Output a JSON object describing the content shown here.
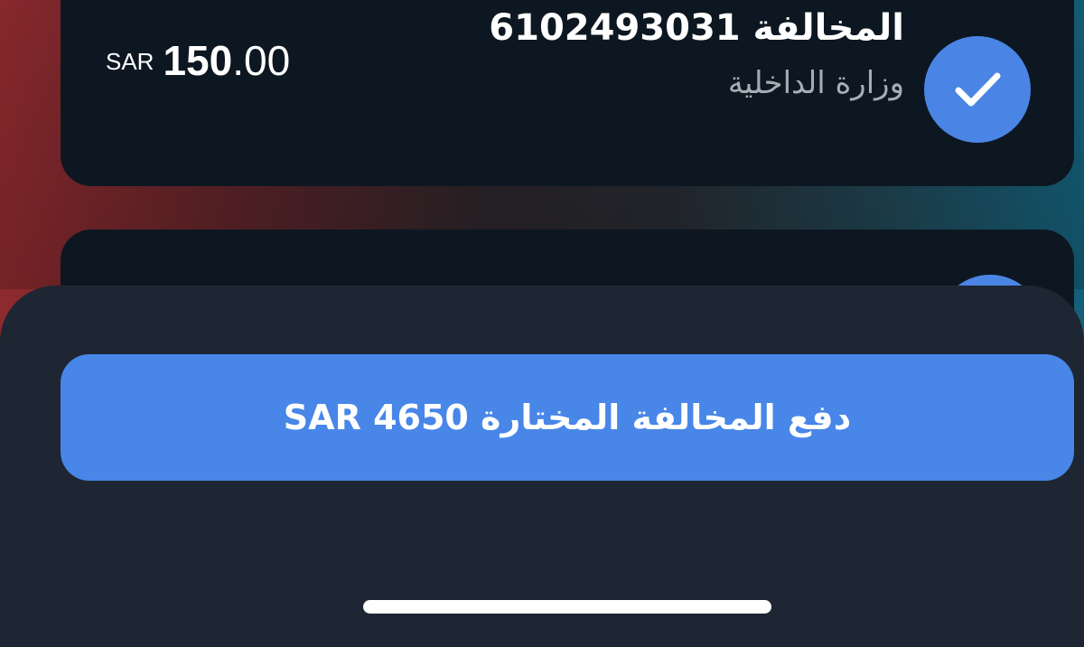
{
  "violations": [
    {
      "title": "المخالفة 6102493031",
      "authority": "وزارة الداخلية",
      "currency": "SAR",
      "amount_int": "150",
      "amount_dec": ".00",
      "selected": true
    },
    {
      "title": "",
      "authority": "",
      "selected": true
    }
  ],
  "pay_button": {
    "label": "دفع المخالفة المختارة SAR 4650"
  },
  "colors": {
    "accent": "#4886e8",
    "card_bg": "#0d1721",
    "sheet_bg": "#1d2632",
    "secondary_text": "#a7adb4"
  },
  "icons": {
    "check": "check-icon"
  }
}
